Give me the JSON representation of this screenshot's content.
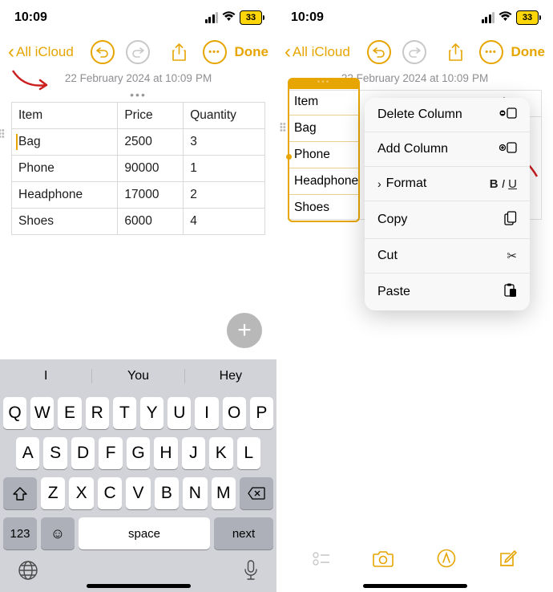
{
  "status": {
    "time": "10:09",
    "battery": "33"
  },
  "toolbar": {
    "back_label": "All iCloud",
    "done_label": "Done"
  },
  "date": {
    "text": "22 February 2024 at 10:09",
    "suffix": "PM"
  },
  "table": {
    "headers": [
      "Item",
      "Price",
      "Quantity"
    ],
    "rows": [
      [
        "Bag",
        "2500",
        "3"
      ],
      [
        "Phone",
        "90000",
        "1"
      ],
      [
        "Headphone",
        "17000",
        "2"
      ],
      [
        "Shoes",
        "6000",
        "4"
      ]
    ]
  },
  "keyboard": {
    "suggestions": [
      "I",
      "You",
      "Hey"
    ],
    "row1": [
      "Q",
      "W",
      "E",
      "R",
      "T",
      "Y",
      "U",
      "I",
      "O",
      "P"
    ],
    "row2": [
      "A",
      "S",
      "D",
      "F",
      "G",
      "H",
      "J",
      "K",
      "L"
    ],
    "row3": [
      "Z",
      "X",
      "C",
      "V",
      "B",
      "N",
      "M"
    ],
    "num_label": "123",
    "space_label": "space",
    "next_label": "next"
  },
  "context_menu": {
    "items": [
      {
        "label": "Delete Column",
        "icon": "delete-col"
      },
      {
        "label": "Add Column",
        "icon": "add-col"
      },
      {
        "label": "Format",
        "icon": "format",
        "chevron": true
      },
      {
        "label": "Copy",
        "icon": "copy"
      },
      {
        "label": "Cut",
        "icon": "cut"
      },
      {
        "label": "Paste",
        "icon": "paste"
      }
    ]
  },
  "right_table": {
    "col1": [
      "Item",
      "Bag",
      "Phone",
      "Headphone",
      "Shoes"
    ],
    "short": [
      "Ite",
      "Ba",
      "Ph",
      "He",
      "Sh"
    ],
    "other_hdr": "tity"
  }
}
